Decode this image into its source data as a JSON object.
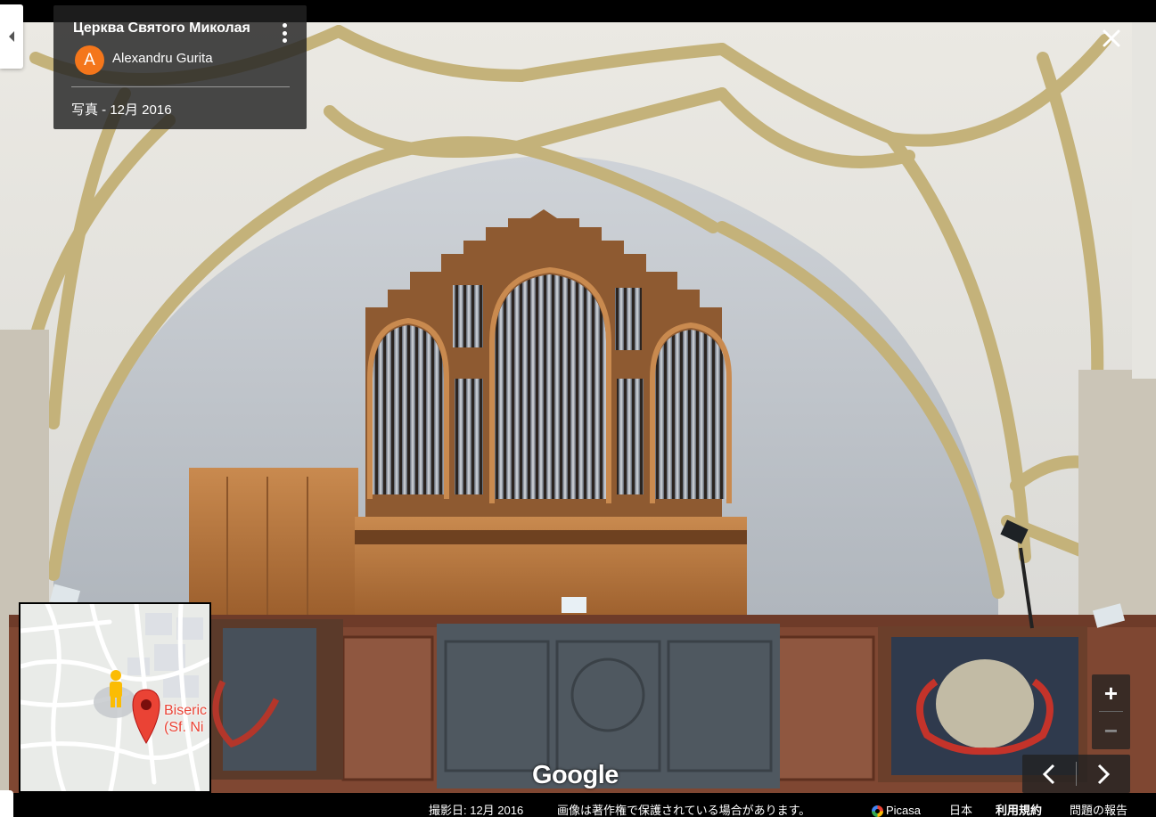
{
  "info_card": {
    "title": "Церква Святого Миколая",
    "avatar_letter": "A",
    "author": "Alexandru Gurita",
    "date": "写真 - 12月 2016",
    "avatar_color": "#f4761b"
  },
  "map": {
    "place_label_line1": "Biseric",
    "place_label_line2": "(Sf. Ni",
    "pin_color": "#ea4335",
    "pegman_color": "#fbbc04"
  },
  "controls": {
    "zoom_in": "+",
    "zoom_out": "−"
  },
  "watermark": "Google",
  "footer": {
    "capture_date": "撮影日: 12月 2016",
    "copyright": "画像は著作権で保護されている場合があります。",
    "picasa": "Picasa",
    "region": "日本",
    "terms": "利用規約",
    "report": "問題の報告"
  }
}
